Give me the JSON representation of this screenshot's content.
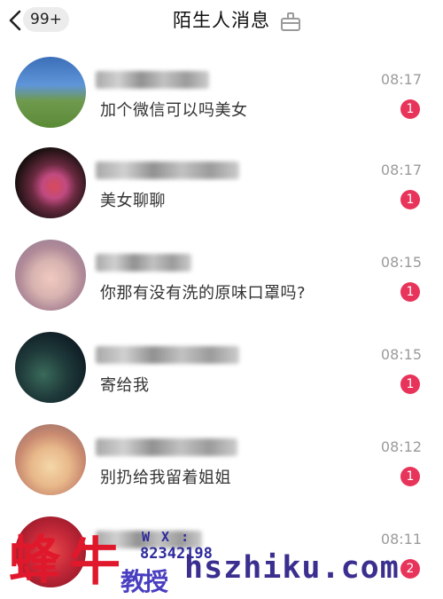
{
  "header": {
    "back_label": "返回",
    "unread_total": "99+",
    "title": "陌生人消息",
    "clear_icon": "clear-broom-icon"
  },
  "messages": [
    {
      "text": "加个微信可以吗美女",
      "time": "08:17",
      "unread": "1"
    },
    {
      "text": "美女聊聊",
      "time": "08:17",
      "unread": "1"
    },
    {
      "text": "你那有没有洗的原味口罩吗?",
      "time": "08:15",
      "unread": "1"
    },
    {
      "text": "寄给我",
      "time": "08:15",
      "unread": "1"
    },
    {
      "text": "别扔给我留着姐姐",
      "time": "08:12",
      "unread": "1"
    },
    {
      "text": "",
      "time": "08:11",
      "unread": "2"
    }
  ],
  "watermark": {
    "logo_a": "蜂",
    "logo_b": "牛",
    "wx_label": "W X :",
    "wx_number": "82342198",
    "edu_text": "教授",
    "site": "hszhiku.com"
  },
  "colors": {
    "badge_red": "#e8345a",
    "watermark_red": "#e0182c",
    "watermark_blue": "#2e2b9c"
  }
}
